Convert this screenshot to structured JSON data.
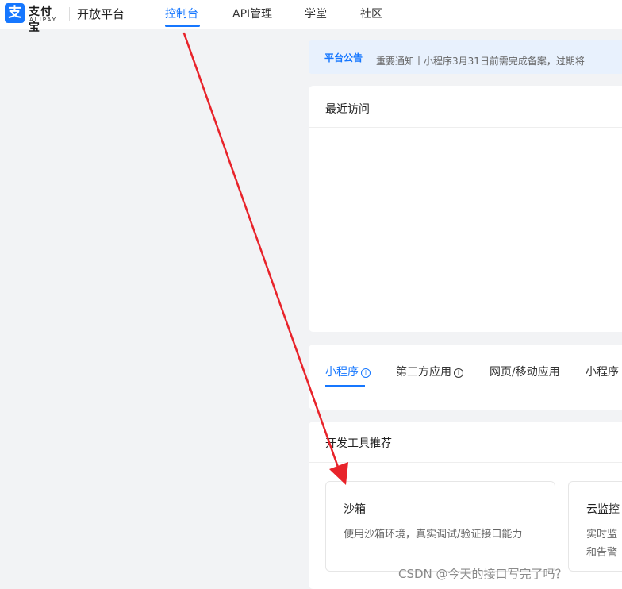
{
  "header": {
    "logo_cn": "支付宝",
    "logo_en": "ALIPAY",
    "logo_glyph": "支",
    "platform": "开放平台",
    "nav": [
      {
        "label": "控制台",
        "active": true
      },
      {
        "label": "API管理"
      },
      {
        "label": "学堂"
      },
      {
        "label": "社区"
      }
    ]
  },
  "notice": {
    "label": "平台公告",
    "text": "重要通知丨小程序3月31日前需完成备案，过期将"
  },
  "recent": {
    "title": "最近访问"
  },
  "app_tabs": [
    {
      "label": "小程序",
      "active": true,
      "info": true
    },
    {
      "label": "第三方应用",
      "info": true
    },
    {
      "label": "网页/移动应用"
    },
    {
      "label": "小程序"
    }
  ],
  "tools": {
    "title": "开发工具推荐",
    "items": [
      {
        "title": "沙箱",
        "desc": "使用沙箱环境，真实调试/验证接口能力"
      },
      {
        "title": "云监控",
        "desc_line1": "实时监",
        "desc_line2": "和告警"
      }
    ]
  },
  "watermark": "CSDN @今天的接口写完了吗？",
  "colors": {
    "accent": "#1677ff",
    "annotation_arrow": "#e8232a",
    "notice_bg": "#e8f1fd"
  },
  "icons": {
    "info": "info-circle-icon"
  }
}
